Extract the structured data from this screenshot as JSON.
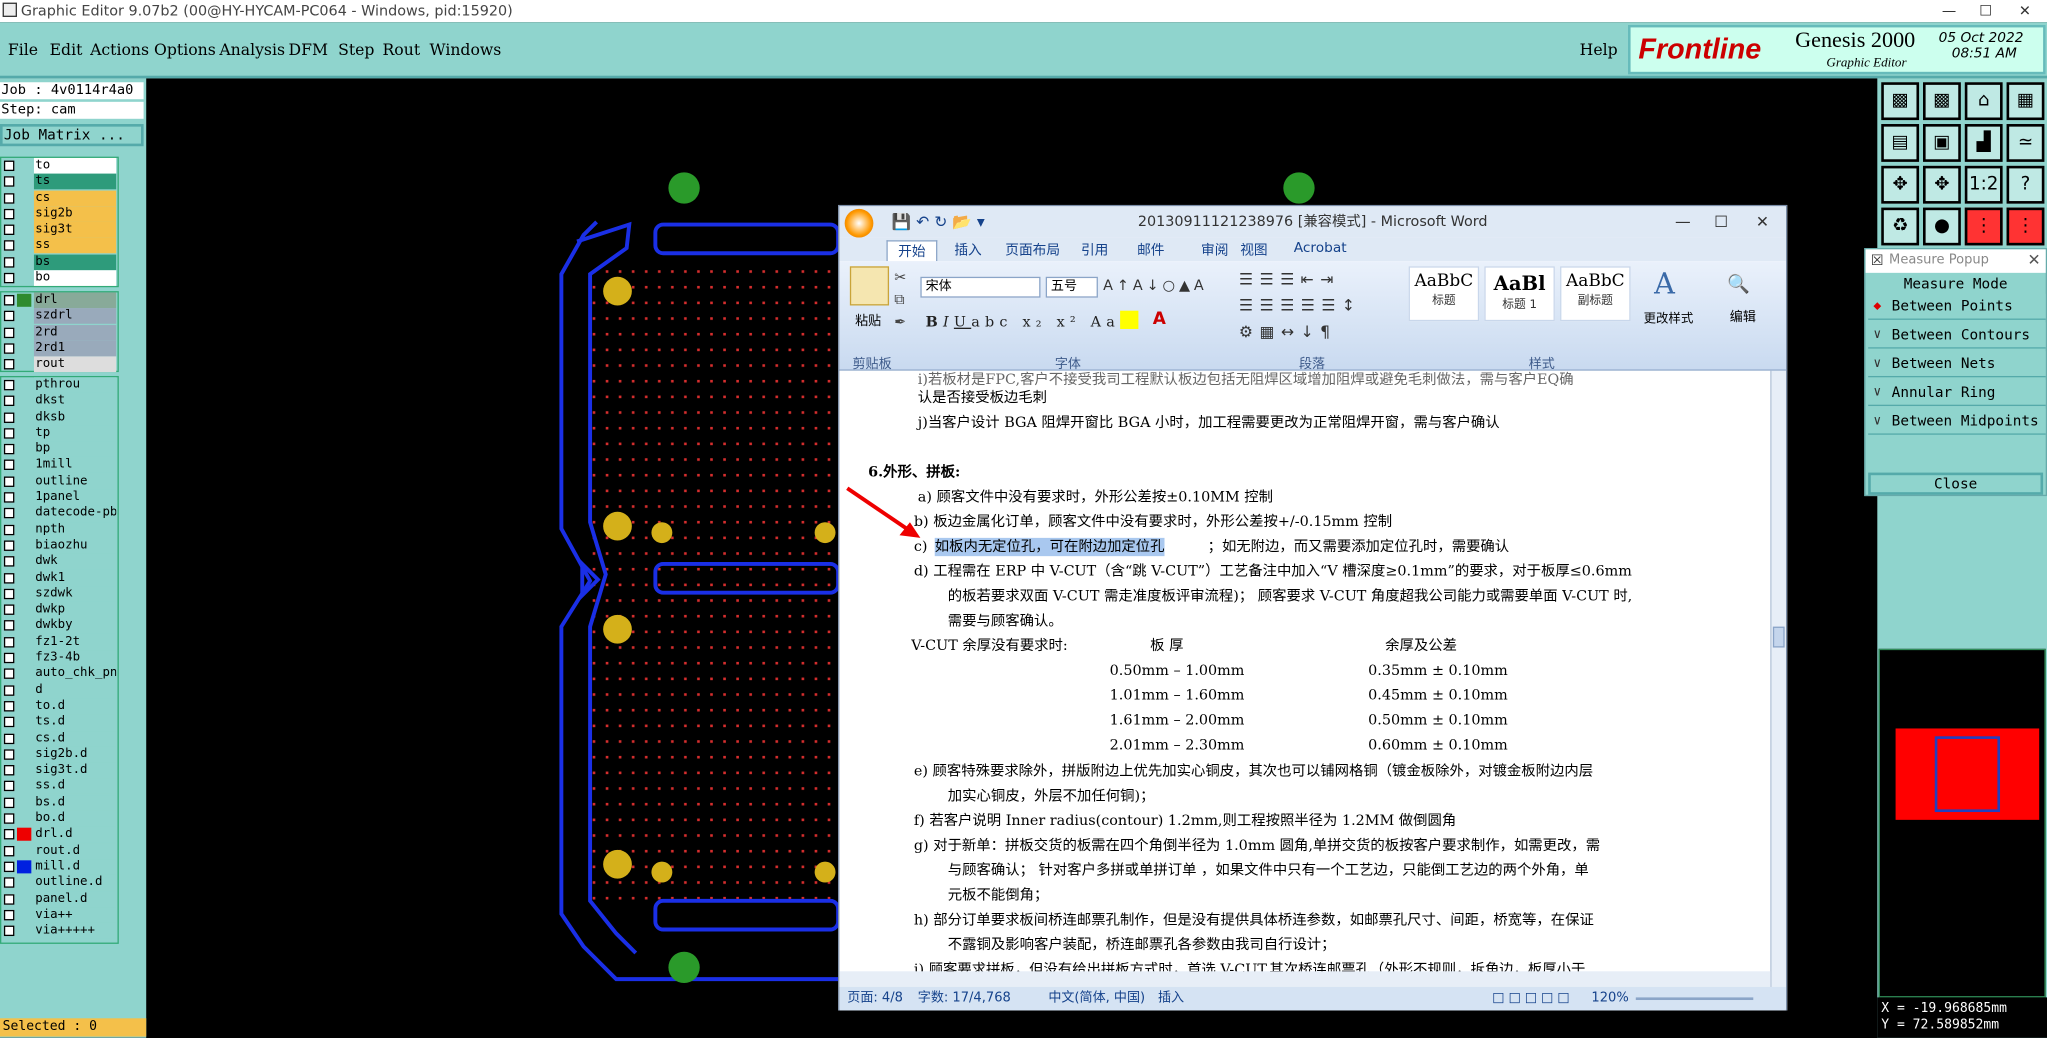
{
  "window": {
    "title": "Graphic Editor 9.07b2 (00@HY-HYCAM-PC064 - Windows, pid:15920)"
  },
  "menu": [
    "File",
    "Edit",
    "Actions",
    "Options",
    "Analysis",
    "DFM",
    "Step",
    "Rout",
    "Windows"
  ],
  "help": "Help",
  "logo": {
    "brand": "Frontline",
    "product": "Genesis 2000",
    "sub": "Graphic Editor",
    "date": "05 Oct 2022",
    "time": "08:51 AM"
  },
  "left": {
    "job": "Job : 4v0114r4a0",
    "step": "Step: cam",
    "job_matrix": "Job Matrix ...",
    "group1": [
      {
        "name": "to",
        "color": "#ffffff"
      },
      {
        "name": "ts",
        "color": "#2e9b7b"
      },
      {
        "name": "cs",
        "color": "#f4c04a"
      },
      {
        "name": "sig2b",
        "color": "#f4c04a"
      },
      {
        "name": "sig3t",
        "color": "#f4c04a"
      },
      {
        "name": "ss",
        "color": "#f4c04a"
      },
      {
        "name": "bs",
        "color": "#2e9b7b"
      },
      {
        "name": "bo",
        "color": "#ffffff"
      }
    ],
    "group2": [
      {
        "name": "drl",
        "color": "#8a9",
        "sw": "#2e8b2e"
      },
      {
        "name": "szdrl",
        "color": "#9ab"
      },
      {
        "name": "2rd",
        "color": "#9ab"
      },
      {
        "name": "2rd1",
        "color": "#9ab"
      },
      {
        "name": "rout",
        "color": "#ddd"
      }
    ],
    "group3": [
      "pthrou",
      "dkst",
      "dksb",
      "tp",
      "bp",
      "1mill",
      "outline",
      "1panel",
      "datecode-pbe",
      "npth",
      "biaozhu",
      "dwk",
      "dwk1",
      "szdwk",
      "dwkp",
      "dwkby",
      "fz1-2t",
      "fz3-4b",
      "auto_chk_pnl",
      "d",
      "to.d",
      "ts.d",
      "cs.d",
      "sig2b.d",
      "sig3t.d",
      "ss.d",
      "bs.d",
      "bo.d",
      "drl.d",
      "rout.d",
      "mill.d",
      "outline.d",
      "panel.d",
      "via++",
      "via+++++"
    ],
    "selected": "Selected : 0"
  },
  "measure": {
    "title": "Measure Popup",
    "mode": "Measure Mode",
    "items": [
      "Between Points",
      "Between Contours",
      "Between Nets",
      "Annular Ring",
      "Between Midpoints"
    ],
    "close": "Close"
  },
  "coords": {
    "x": "X = -19.968685mm",
    "y": "Y = 72.589852mm"
  },
  "word": {
    "title": "20130911121238976 [兼容模式] - Microsoft Word",
    "tabs": [
      "开始",
      "插入",
      "页面布局",
      "引用",
      "邮件",
      "审阅",
      "视图",
      "Acrobat"
    ],
    "font": "宋体",
    "size": "五号",
    "styles": [
      {
        "sample": "AaBbC",
        "name": "标题"
      },
      {
        "sample": "AaBl",
        "name": "标题 1"
      },
      {
        "sample": "AaBbC",
        "name": "副标题"
      }
    ],
    "change_style": "更改样式",
    "edit": "编辑",
    "paste": "粘贴",
    "groups": [
      "剪贴板",
      "字体",
      "段落",
      "样式"
    ],
    "lines": [
      "i)若板材是FPC,客户不接受我司工程默认板边包括无阻焊区域增加阻焊或避免毛刺做法，需与客户EQ确",
      "认是否接受板边毛刺",
      "j)当客户设计 BGA 阻焊开窗比 BGA 小时，加工程需要更改为正常阻焊开窗，需与客户确认",
      "6.外形、拼板:",
      "a) 顾客文件中没有要求时，外形公差按±0.10MM 控制",
      "b) 板边金属化订单，顾客文件中没有要求时，外形公差按+/-0.15mm 控制",
      "如板内无定位孔，可在附边加定位孔",
      "；如无附边，而又需要添加定位孔时，需要确认",
      "d) 工程需在 ERP 中 V-CUT（含“跳 V-CUT”）工艺备注中加入“V 槽深度≥0.1mm”的要求，对于板厚≤0.6mm",
      "的板若要求双面 V-CUT 需走准度板评审流程)； 顾客要求 V-CUT 角度超我公司能力或需要单面 V-CUT 时,",
      "需要与顾客确认。",
      "V-CUT 余厚没有要求时:",
      "板   厚",
      "余厚及公差",
      "e) 顾客特殊要求除外，拼版附边上优先加实心铜皮，其次也可以铺网格铜（镀金板除外，对镀金板附边内层",
      "加实心铜皮，外层不加任何铜)；",
      "f) 若客户说明 Inner radius(contour) 1.2mm,则工程按照半径为 1.2MM 做倒圆角",
      "g) 对于新单：拼板交货的板需在四个角倒半径为 1.0mm 圆角,单拼交货的板按客户要求制作，如需更改，需",
      "与顾客确认；  针对客户多拼或单拼订单 ，如果文件中只有一个工艺边，只能倒工艺边的两个外角，单",
      "元板不能倒角；",
      "h) 部分订单要求板间桥连邮票孔制作，但是没有提供具体桥连参数，如邮票孔尺寸、间距，桥宽等，在保证",
      "不露铜及影响客户装配，桥连邮票孔各参数由我司自行设计；",
      "i) 顾客要求拼板，但没有给出拼板方式时，首选 V-CUT,其次桥连邮票孔（外形不规则，拆角边，板厚小于"
    ],
    "item_c": "c)",
    "table": [
      [
        "0.50mm – 1.00mm",
        "0.35mm ± 0.10mm"
      ],
      [
        "1.01mm – 1.60mm",
        "0.45mm ± 0.10mm"
      ],
      [
        "1.61mm – 2.00mm",
        "0.50mm ± 0.10mm"
      ],
      [
        "2.01mm – 2.30mm",
        "0.60mm ± 0.10mm"
      ]
    ],
    "status": {
      "page": "页面: 4/8",
      "words": "字数: 17/4,768",
      "lang": "中文(简体, 中国)",
      "mode": "插入",
      "zoom": "120%"
    }
  }
}
